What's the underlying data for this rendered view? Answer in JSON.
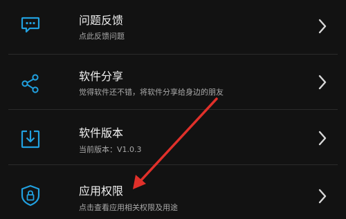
{
  "colors": {
    "background": "#121212",
    "accent_blue": "#21a0df",
    "title_text": "#f0f0f0",
    "subtitle_text": "#a9a9a9",
    "chevron": "#d8d8d8",
    "annotation_red": "#e0302a"
  },
  "items": [
    {
      "title": "问题反馈",
      "subtitle": "点此反馈问题",
      "icon": "feedback-message-icon"
    },
    {
      "title": "软件分享",
      "subtitle": "觉得软件还不错，将软件分享给身边的朋友",
      "icon": "share-icon"
    },
    {
      "title": "软件版本",
      "subtitle": "当前版本：V1.0.3",
      "icon": "download-box-icon"
    },
    {
      "title": "应用权限",
      "subtitle": "点击查看应用相关权限及用途",
      "icon": "shield-lock-icon"
    }
  ]
}
